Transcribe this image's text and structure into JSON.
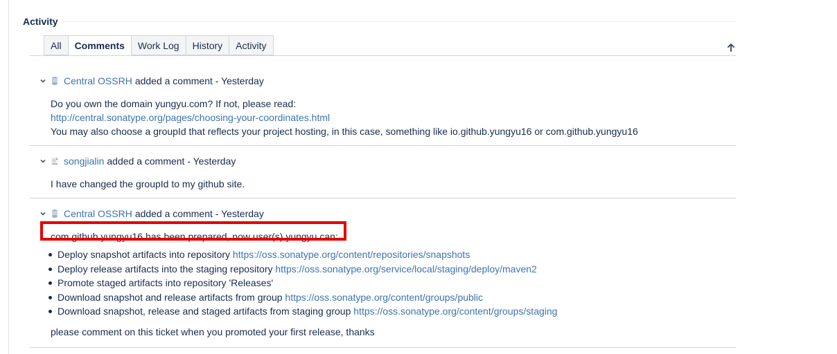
{
  "section": {
    "title": "Activity"
  },
  "tabs": [
    {
      "label": "All",
      "active": false
    },
    {
      "label": "Comments",
      "active": true
    },
    {
      "label": "Work Log",
      "active": false
    },
    {
      "label": "History",
      "active": false
    },
    {
      "label": "Activity",
      "active": false
    }
  ],
  "comments": [
    {
      "author": "Central OSSRH",
      "action": "added a comment - Yesterday",
      "line1": "Do you own the domain yungyu.com? If not, please read:",
      "link": "http://central.sonatype.org/pages/choosing-your-coordinates.html",
      "line3": "You may also choose a groupId that reflects your project hosting, in this case, something like io.github.yungyu16 or com.github.yungyu16"
    },
    {
      "author": "songjialin",
      "action": "added a comment - Yesterday",
      "line1": "I have changed the groupId to my github site."
    },
    {
      "author": "Central OSSRH",
      "action": "added a comment - Yesterday",
      "highlight": "com.github.yungyu16 has been prepared, now user(s) yungyu can:",
      "bullets": [
        {
          "text": "Deploy snapshot artifacts into repository ",
          "link": "https://oss.sonatype.org/content/repositories/snapshots"
        },
        {
          "text": "Deploy release artifacts into the staging repository ",
          "link": "https://oss.sonatype.org/service/local/staging/deploy/maven2"
        },
        {
          "text": "Promote staged artifacts into repository 'Releases'",
          "link": ""
        },
        {
          "text": "Download snapshot and release artifacts from group ",
          "link": "https://oss.sonatype.org/content/groups/public"
        },
        {
          "text": "Download snapshot, release and staged artifacts from staging group ",
          "link": "https://oss.sonatype.org/content/groups/staging"
        }
      ],
      "closing": "please comment on this ticket when you promoted your first release, thanks"
    }
  ]
}
